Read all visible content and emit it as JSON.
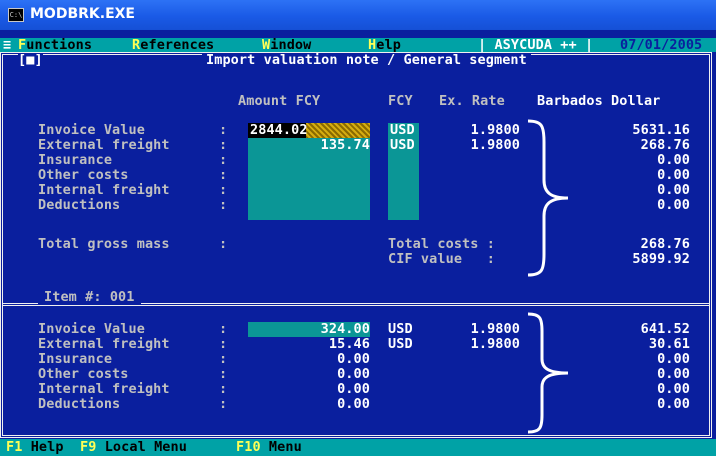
{
  "window": {
    "title": "MODBRK.EXE",
    "icon": "console-icon"
  },
  "menu": {
    "system_glyph": "≡",
    "items": [
      {
        "hot": "F",
        "rest": "unctions"
      },
      {
        "hot": "R",
        "rest": "eferences"
      },
      {
        "hot": "W",
        "rest": "indow"
      },
      {
        "hot": "H",
        "rest": "elp"
      }
    ],
    "app_name": "| ASYCUDA ++ |",
    "date": "07/01/2005"
  },
  "form": {
    "close_glyph": "[■]",
    "title": "Import valuation note / General segment",
    "headers": {
      "amount": "Amount FCY",
      "fcy": "FCY",
      "rate": "Ex. Rate",
      "local": "Barbados Dollar"
    },
    "general_rows": [
      {
        "label": "Invoice Value",
        "sep": ":",
        "amount": "2844.02",
        "fcy": "USD",
        "rate": "1.9800",
        "local": "5631.16"
      },
      {
        "label": "External freight",
        "sep": ":",
        "amount": "135.74",
        "fcy": "USD",
        "rate": "1.9800",
        "local": "268.76"
      },
      {
        "label": "Insurance",
        "sep": ":",
        "amount": "",
        "fcy": "",
        "rate": "",
        "local": "0.00"
      },
      {
        "label": "Other costs",
        "sep": ":",
        "amount": "",
        "fcy": "",
        "rate": "",
        "local": "0.00"
      },
      {
        "label": "Internal freight",
        "sep": ":",
        "amount": "",
        "fcy": "",
        "rate": "",
        "local": "0.00"
      },
      {
        "label": "Deductions",
        "sep": ":",
        "amount": "",
        "fcy": "",
        "rate": "",
        "local": "0.00"
      }
    ],
    "gross_mass": {
      "label": "Total gross mass",
      "sep": ":"
    },
    "totals": [
      {
        "label": "Total costs :",
        "value": "268.76"
      },
      {
        "label": "CIF value   :",
        "value": "5899.92"
      }
    ],
    "item_header": "Item #: 001",
    "item_rows": [
      {
        "label": "Invoice Value",
        "sep": ":",
        "amount": "324.00",
        "fcy": "USD",
        "rate": "1.9800",
        "local": "641.52"
      },
      {
        "label": "External freight",
        "sep": ":",
        "amount": "15.46",
        "fcy": "USD",
        "rate": "1.9800",
        "local": "30.61"
      },
      {
        "label": "Insurance",
        "sep": ":",
        "amount": "0.00",
        "fcy": "",
        "rate": "",
        "local": "0.00"
      },
      {
        "label": "Other costs",
        "sep": ":",
        "amount": "0.00",
        "fcy": "",
        "rate": "",
        "local": "0.00"
      },
      {
        "label": "Internal freight",
        "sep": ":",
        "amount": "0.00",
        "fcy": "",
        "rate": "",
        "local": "0.00"
      },
      {
        "label": "Deductions",
        "sep": ":",
        "amount": "0.00",
        "fcy": "",
        "rate": "",
        "local": "0.00"
      }
    ]
  },
  "status": {
    "keys": [
      {
        "key": "F1",
        "label": "Help"
      },
      {
        "key": "F9",
        "label": "Local Menu"
      },
      {
        "key": "F10",
        "label": "Menu"
      }
    ]
  },
  "colors": {
    "background": "#0a1f9e",
    "menubar": "#00a2a6",
    "field": "#0b9696",
    "text": "#c0c0c0",
    "highlight": "#ffff55"
  }
}
